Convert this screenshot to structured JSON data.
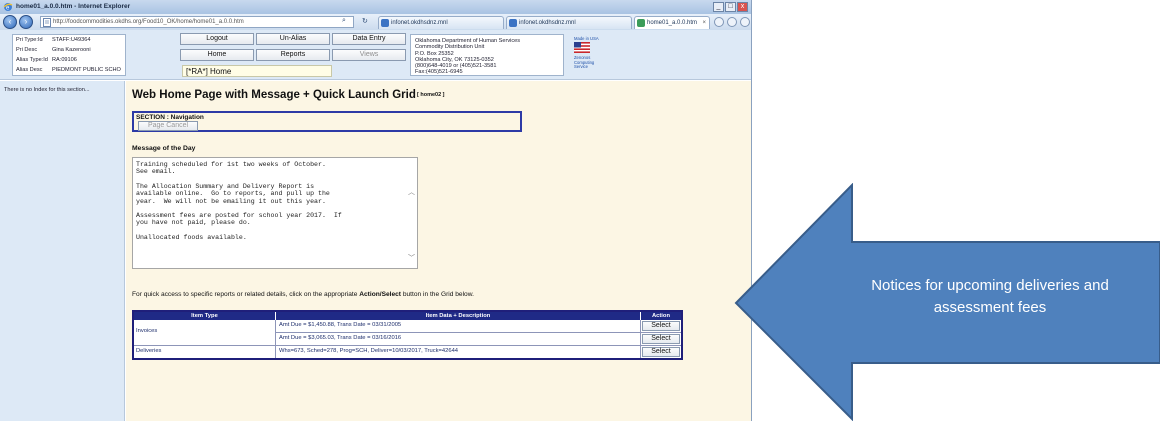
{
  "window": {
    "title": "home01_a.0.0.htm - Internet Explorer",
    "min": "_",
    "max": "□",
    "close": "x"
  },
  "browser": {
    "address": "http://foodcommodities.okdhs.org/Food10_OK/home/home01_a.0.0.htm",
    "tabs": [
      {
        "label": "infonet.okdhsdnz.mnl"
      },
      {
        "label": "infonet.okdhsdnz.mnl"
      },
      {
        "label": "home01_a.0.0.htm"
      }
    ]
  },
  "userinfo": {
    "rows": [
      {
        "label": "Pri Type:Id",
        "value": "STAFF:U49364"
      },
      {
        "label": "Pri Desc",
        "value": "Gina Kazerooni"
      },
      {
        "label": "Alias Type:Id",
        "value": "RA:09106"
      },
      {
        "label": "Alias Desc",
        "value": "PIEDMONT PUBLIC SCHO"
      }
    ]
  },
  "toolbar": {
    "logout": "Logout",
    "unalias": "Un-Alias",
    "data_entry": "Data Entry",
    "home": "Home",
    "reports": "Reports",
    "views": "Views",
    "home_title": "[*RA*] Home"
  },
  "agency": {
    "lines": [
      "Oklahoma Department of Human Services",
      "Commodity Distribution Unit",
      "P.O. Box 25352",
      "Oklahoma City, OK 73125-0352",
      "(800)648-4019 or (405)521-3581",
      "Fax:(405)521-6945"
    ]
  },
  "badge": {
    "made_in": "Made in USA",
    "vendor": "Zenonos Computing Service"
  },
  "sidebar": {
    "text": "There is no Index for this section..."
  },
  "main": {
    "title": "Web Home Page with Message + Quick Launch Grid",
    "code": "[ home02 ]",
    "section_label": "SECTION : Navigation",
    "page_cancel": "Page Cancel",
    "motd_title": "Message of the Day",
    "motd": [
      "Training scheduled for 1st two weeks of October.\nSee email.",
      "The Allocation Summary and Delivery Report is\navailable online.  Go to reports, and pull up the\nyear.  We will not be emailing it out this year.",
      "Assessment fees are posted for school year 2017.  If\nyou have not paid, please do.",
      "Unallocated foods available."
    ],
    "quick_access_pre": "For quick access to specific reports or related details, click on the appropriate ",
    "quick_access_bold": "Action/Select",
    "quick_access_post": " button in the Grid below."
  },
  "grid": {
    "headers": {
      "item_type": "Item Type",
      "item_data": "Item Data + Description",
      "action": "Action"
    },
    "rows": [
      {
        "type": "Invoices",
        "data": "Amt Due = $1,450.88, Trans Date = 03/31/2005",
        "action": "Select"
      },
      {
        "type": "",
        "data": "Amt Due = $3,065.03, Trans Date = 03/16/2016",
        "action": "Select"
      },
      {
        "type": "Deliveries",
        "data": "Whs=673, Sched=278, Prog=SCH, Deliver=10/03/2017, Truck=42644",
        "action": "Select"
      }
    ]
  },
  "callout": {
    "text": "Notices for upcoming deliveries and assessment fees",
    "fill": "#4f81bd",
    "stroke": "#385d8a"
  }
}
